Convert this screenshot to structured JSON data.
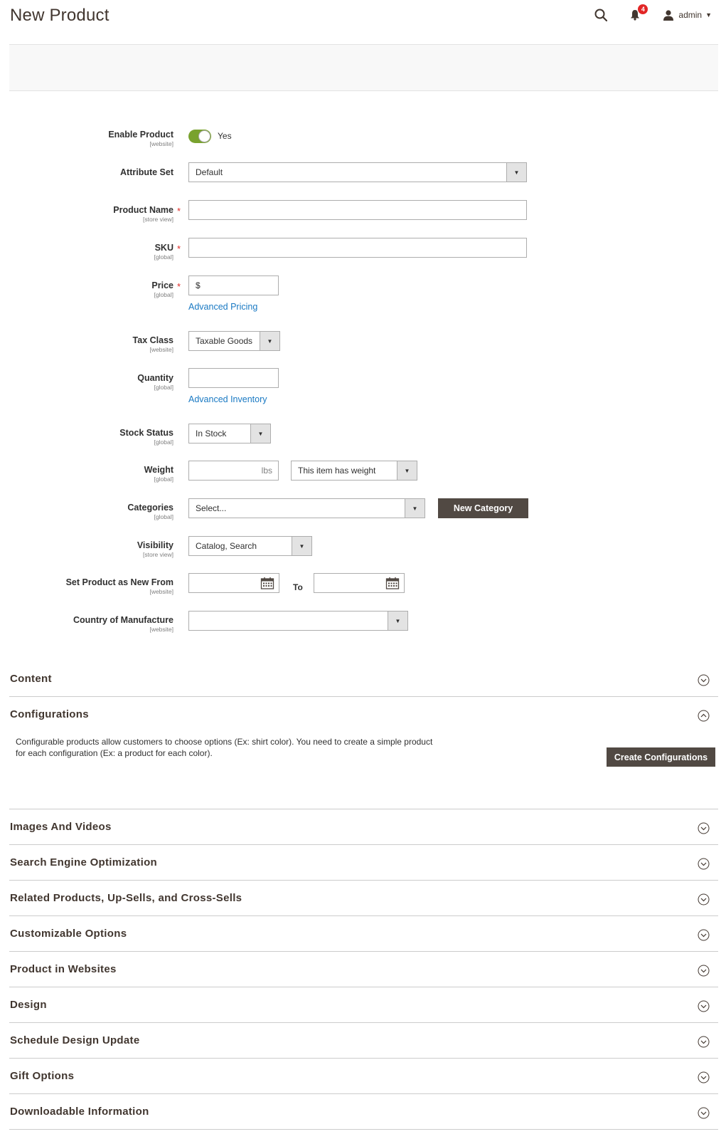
{
  "page": {
    "title": "New Product"
  },
  "header": {
    "notification_count": "4",
    "username": "admin"
  },
  "form": {
    "enable_product": {
      "label": "Enable Product",
      "scope": "[website]",
      "value": "Yes",
      "enabled": true
    },
    "attribute_set": {
      "label": "Attribute Set",
      "value": "Default"
    },
    "product_name": {
      "label": "Product Name",
      "scope": "[store view]",
      "value": ""
    },
    "sku": {
      "label": "SKU",
      "scope": "[global]",
      "value": ""
    },
    "price": {
      "label": "Price",
      "scope": "[global]",
      "placeholder": "$",
      "link": "Advanced Pricing"
    },
    "tax_class": {
      "label": "Tax Class",
      "scope": "[website]",
      "value": "Taxable Goods"
    },
    "quantity": {
      "label": "Quantity",
      "scope": "[global]",
      "value": "",
      "link": "Advanced Inventory"
    },
    "stock_status": {
      "label": "Stock Status",
      "scope": "[global]",
      "value": "In Stock"
    },
    "weight": {
      "label": "Weight",
      "scope": "[global]",
      "unit": "lbs",
      "type_value": "This item has weight"
    },
    "categories": {
      "label": "Categories",
      "scope": "[global]",
      "placeholder": "Select...",
      "button": "New Category"
    },
    "visibility": {
      "label": "Visibility",
      "scope": "[store view]",
      "value": "Catalog, Search"
    },
    "new_from": {
      "label": "Set Product as New From",
      "scope": "[website]",
      "to_label": "To"
    },
    "country": {
      "label": "Country of Manufacture",
      "scope": "[website]",
      "value": ""
    }
  },
  "sections": {
    "content": "Content",
    "configurations": "Configurations",
    "configurations_desc": "Configurable products allow customers to choose options (Ex: shirt color). You need to create a simple product for each configuration (Ex: a product for each color).",
    "create_configurations": "Create Configurations",
    "images": "Images And Videos",
    "seo": "Search Engine Optimization",
    "related": "Related Products, Up-Sells, and Cross-Sells",
    "custom_options": "Customizable Options",
    "websites": "Product in Websites",
    "design": "Design",
    "schedule": "Schedule Design Update",
    "gift": "Gift Options",
    "downloadable": "Downloadable Information"
  },
  "colors": {
    "toggle_on": "#79a22e",
    "link": "#1979c3",
    "button_dark": "#514943",
    "required": "#e02b27",
    "badge": "#e22626"
  }
}
